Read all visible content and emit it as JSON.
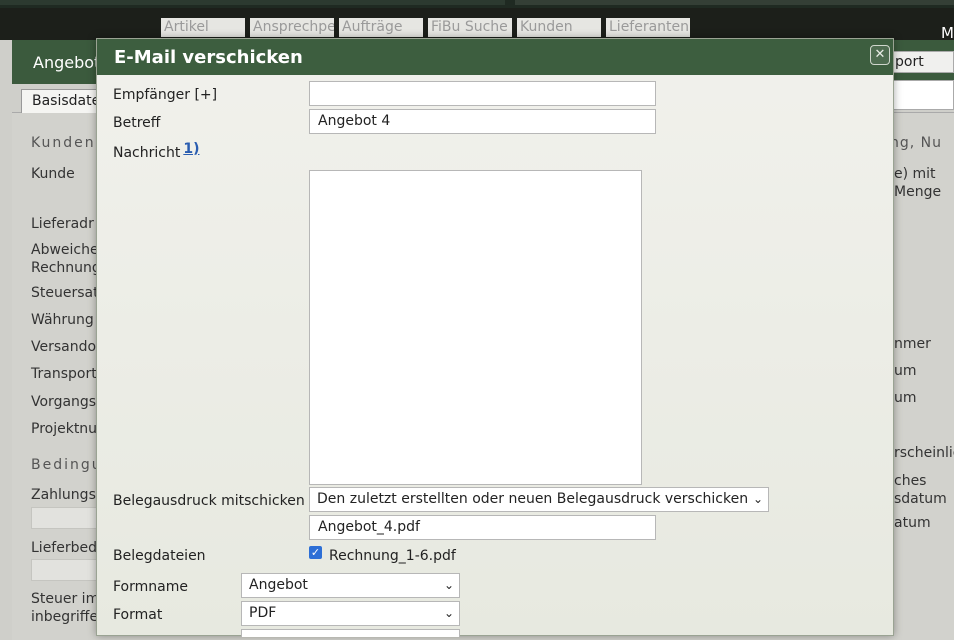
{
  "topnav": {
    "items": [
      "Artikel",
      "Ansprechpe",
      "Aufträge",
      "FiBu Suche",
      "Kunden",
      "Lieferanten"
    ],
    "right_letter": "M"
  },
  "background": {
    "header_title": "Angebot",
    "tab_label": "Basisdaten",
    "export_label": "port",
    "section_kunde": "Kunden",
    "section_bedingungen": "Bedingu",
    "labels": [
      "Kunde",
      "Lieferadr",
      "Abweiche",
      "Rechnung",
      "Steuersat",
      "Währung",
      "Versando",
      "Transport",
      "Vorgangs",
      "Projektnu",
      "Zahlungs",
      "Lieferbed",
      "Steuer im",
      "inbegriffe"
    ],
    "right_texts": [
      "ng, Nu",
      "e) mit",
      "Menge",
      "nmer",
      "um",
      "um",
      "rscheinlic",
      "ches",
      "sdatum",
      "atum"
    ]
  },
  "modal": {
    "title": "E-Mail verschicken",
    "close_icon": "close-icon",
    "labels": {
      "empfaenger": "Empfänger [+]",
      "betreff": "Betreff",
      "nachricht": "Nachricht",
      "nachricht_footnote": "1)",
      "belegausdruck": "Belegausdruck mitschicken",
      "belegdateien": "Belegdateien",
      "formname": "Formname",
      "format": "Format"
    },
    "fields": {
      "empfaenger_value": "",
      "betreff_value": "Angebot 4",
      "nachricht_value": "",
      "belegausdruck_value": "Den zuletzt erstellten oder neuen Belegausdruck verschicken",
      "attachment_filename": "Angebot_4.pdf",
      "belegdatei_file": "Rechnung_1-6.pdf",
      "belegdatei_checked": true,
      "formname_value": "Angebot",
      "format_value": "PDF"
    }
  }
}
